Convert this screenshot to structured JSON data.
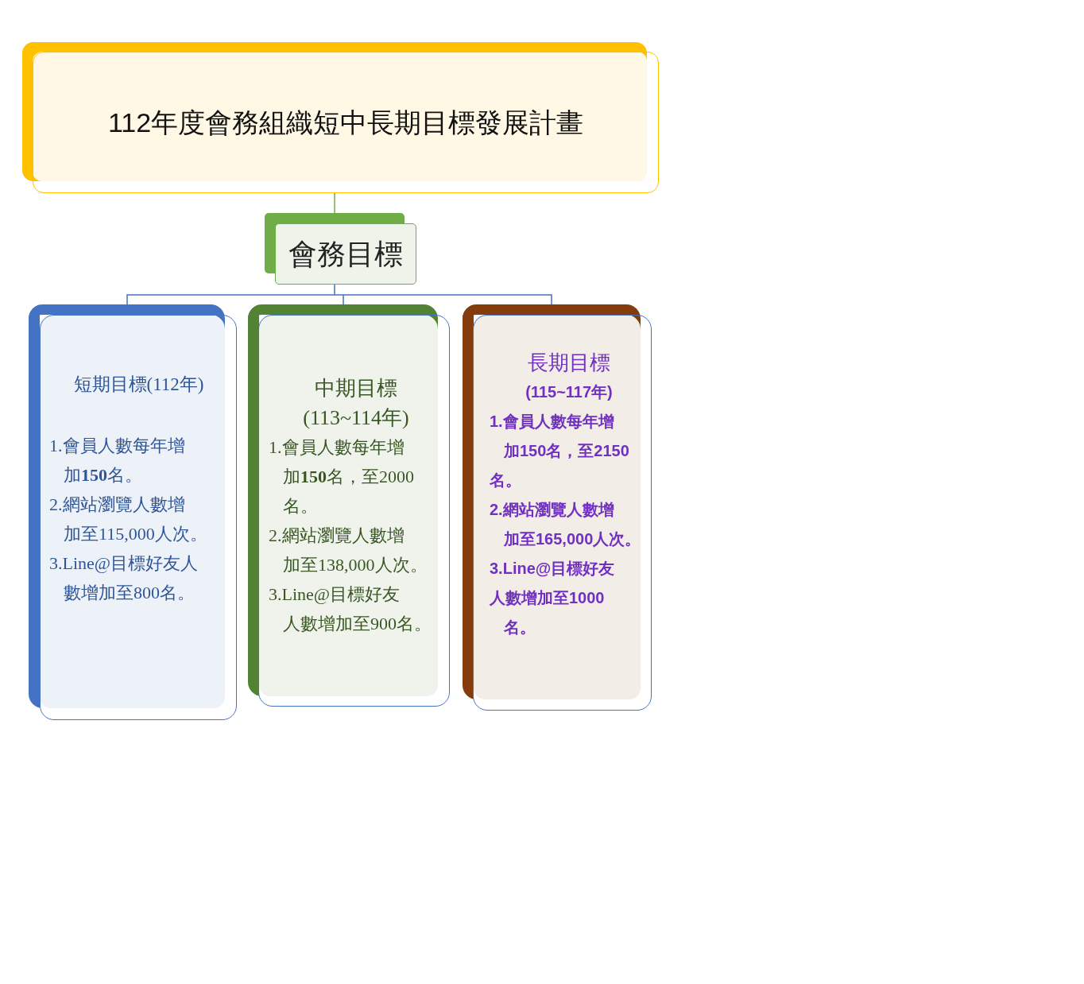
{
  "title": "112年度會務組織短中長期目標發展計畫",
  "goal": "會務目標",
  "columns": [
    {
      "kind": "blue",
      "color": "#4472c4",
      "bold": false,
      "lines": [
        {
          "kind": "title",
          "text": "短期目標(112年)"
        },
        {
          "kind": "item",
          "text": "1.會員人數每年增"
        },
        {
          "kind": "cont",
          "text": "加**150**名。"
        },
        {
          "kind": "item",
          "text": "2.網站瀏覽人數增"
        },
        {
          "kind": "cont",
          "text": "加至115,000人次。"
        },
        {
          "kind": "item",
          "text": "3.Line@目標好友人"
        },
        {
          "kind": "cont",
          "text": "數增加至800名。"
        }
      ]
    },
    {
      "kind": "green",
      "color": "#548235",
      "bold": false,
      "lines": [
        {
          "kind": "title",
          "text": "中期目標"
        },
        {
          "kind": "title",
          "text": "(113~114年)"
        },
        {
          "kind": "item",
          "text": "1.會員人數每年增"
        },
        {
          "kind": "cont",
          "text": "加**150**名，至2000"
        },
        {
          "kind": "cont",
          "text": "名。"
        },
        {
          "kind": "item",
          "text": "2.網站瀏覽人數增"
        },
        {
          "kind": "cont",
          "text": "加至138,000人次。"
        },
        {
          "kind": "item",
          "text": "3.Line@目標好友"
        },
        {
          "kind": "cont",
          "text": "人數增加至900名。"
        }
      ]
    },
    {
      "kind": "brown",
      "color": "#843c0c",
      "bold": true,
      "lines": [
        {
          "kind": "title",
          "text": "長期目標"
        },
        {
          "kind": "subtitle",
          "text": "(115~117年)"
        },
        {
          "kind": "item",
          "text": "1.會員人數每年增"
        },
        {
          "kind": "cont",
          "text": "加150名，至2150"
        },
        {
          "kind": "item",
          "text": "名。"
        },
        {
          "kind": "item",
          "text": "2.網站瀏覽人數增"
        },
        {
          "kind": "cont",
          "text": "加至165,000人次。"
        },
        {
          "kind": "item",
          "text": "3.Line@目標好友"
        },
        {
          "kind": "item",
          "text": "人數增加至1000"
        },
        {
          "kind": "cont",
          "text": "名。"
        }
      ]
    }
  ]
}
